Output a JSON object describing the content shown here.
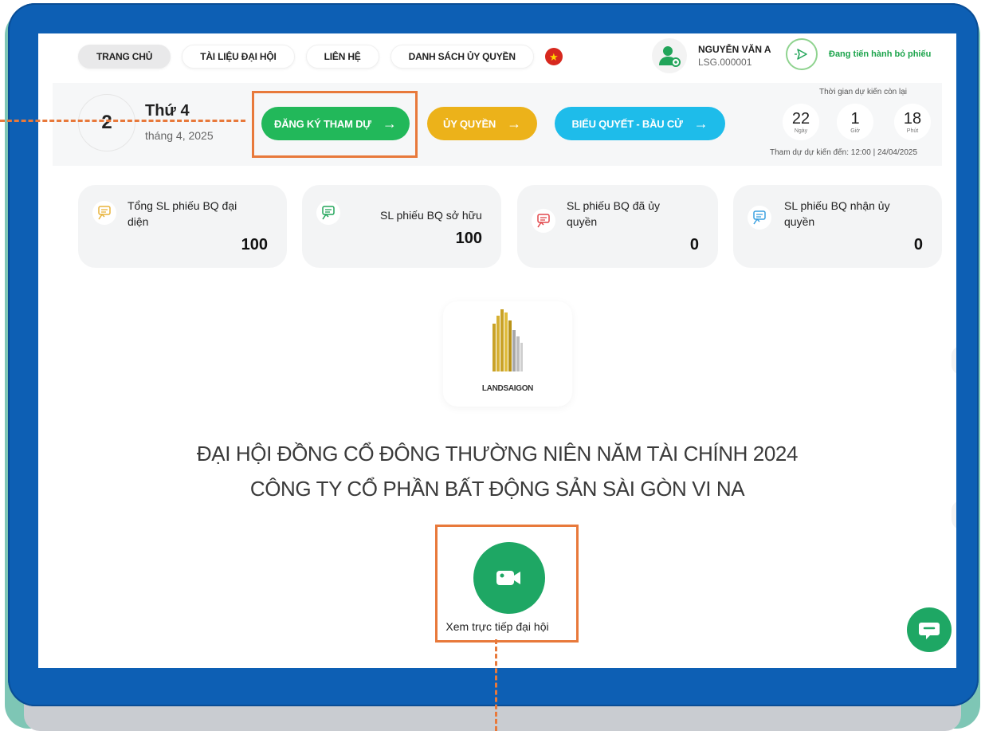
{
  "nav": {
    "items": [
      {
        "label": "TRANG CHỦ",
        "active": true
      },
      {
        "label": "TÀI LIỆU ĐẠI HỘI",
        "active": false
      },
      {
        "label": "LIÊN HỆ",
        "active": false
      },
      {
        "label": "DANH SÁCH ỦY QUYỀN",
        "active": false
      }
    ],
    "language_icon": "vietnam-flag-icon"
  },
  "user": {
    "name": "NGUYỄN VĂN A",
    "code": "LSG.000001",
    "avatar_icon": "user-settings-icon"
  },
  "voting_status": {
    "label": "Đang tiến hành bỏ phiếu",
    "icon": "send-icon"
  },
  "date": {
    "day": "2",
    "weekday": "Thứ 4",
    "month_year": "tháng 4, 2025"
  },
  "actions": {
    "register": "ĐĂNG KÝ THAM DỰ",
    "proxy": "ỦY QUYỀN",
    "vote": "BIỂU QUYẾT - BẦU CỬ"
  },
  "countdown": {
    "label": "Thời gian dự kiến còn lại",
    "days": "22",
    "days_unit": "Ngày",
    "hours": "1",
    "hours_unit": "Giờ",
    "minutes": "18",
    "minutes_unit": "Phút",
    "attend_time": "Tham dự dự kiến đến: 12:00 | 24/04/2025"
  },
  "stats": [
    {
      "label_line1": "Tổng SL phiếu BQ đại",
      "label_line2": "diện",
      "value": "100",
      "icon_color": "#e9b33a"
    },
    {
      "label_line1": "SL phiếu BQ sở hữu",
      "label_line2": "",
      "value": "100",
      "icon_color": "#22a55a"
    },
    {
      "label_line1": "SL phiếu BQ đã ủy",
      "label_line2": "quyền",
      "value": "0",
      "icon_color": "#e2474b"
    },
    {
      "label_line1": "SL phiếu BQ nhận ủy",
      "label_line2": "quyền",
      "value": "0",
      "icon_color": "#3aa0e0"
    }
  ],
  "logo": {
    "text": "LANDSAIGON"
  },
  "meeting": {
    "title_line1": "ĐẠI HỘI ĐỒNG CỔ ĐÔNG THƯỜNG NIÊN NĂM TÀI CHÍNH 2024",
    "title_line2": "CÔNG TY CỔ PHẦN BẤT ĐỘNG SẢN SÀI GÒN VI NA"
  },
  "live": {
    "label": "Xem trực tiếp đại hội",
    "icon": "video-camera-icon"
  },
  "chat": {
    "icon": "chat-icon"
  },
  "colors": {
    "frame_blue": "#0d5fb4",
    "accent_green": "#22b85a",
    "accent_yellow": "#ecb21a",
    "accent_cyan": "#1ebcea",
    "callout_orange": "#e8793b"
  }
}
